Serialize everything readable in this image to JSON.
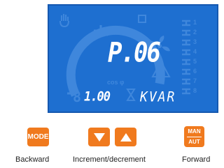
{
  "display": {
    "main_value": "P.06",
    "sub_value": "1.00",
    "unit": "KVAR",
    "cos_phi_label": "cos φ",
    "step_numbers": [
      "1",
      "2",
      "3",
      "4",
      "5",
      "6",
      "7",
      "8"
    ],
    "background_color": "#1e6fd0",
    "text_color": "#ffffff"
  },
  "keys": {
    "mode": "MODE",
    "man": "MAN",
    "aut": "AUT",
    "accent_color": "#f07a1e"
  },
  "captions": {
    "backward": "Backward",
    "increment_decrement": "Increment/decrement",
    "forward": "Forward"
  },
  "icons": [
    "hand-icon",
    "auto-icon",
    "fan-icon",
    "warning-icon",
    "capacitor-icon"
  ]
}
